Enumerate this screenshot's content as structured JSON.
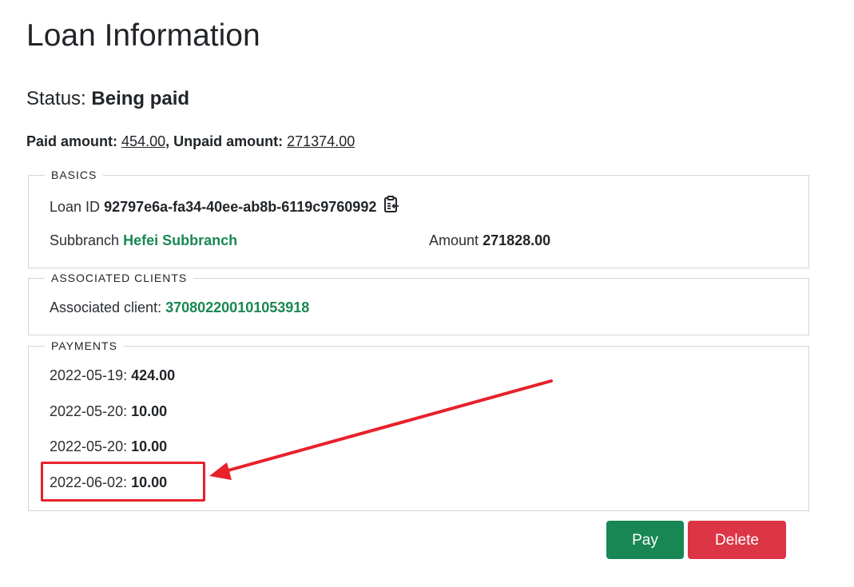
{
  "page": {
    "title": "Loan Information"
  },
  "status": {
    "label": "Status:",
    "value": "Being paid"
  },
  "amounts": {
    "paid_label": "Paid amount:",
    "paid_value": "454.00",
    "separator": ",",
    "unpaid_label": "Unpaid amount:",
    "unpaid_value": "271374.00"
  },
  "basics": {
    "legend": "BASICS",
    "loan_id_label": "Loan ID",
    "loan_id_value": "92797e6a-fa34-40ee-ab8b-6119c9760992",
    "copy_icon": "clipboard-copy-icon",
    "subbranch_label": "Subbranch",
    "subbranch_value": "Hefei Subbranch",
    "amount_label": "Amount",
    "amount_value": "271828.00"
  },
  "associated_clients": {
    "legend": "ASSOCIATED CLIENTS",
    "client_label": "Associated client:",
    "client_value": "370802200101053918"
  },
  "payments": {
    "legend": "PAYMENTS",
    "items": [
      {
        "date": "2022-05-19",
        "amount": "424.00"
      },
      {
        "date": "2022-05-20",
        "amount": "10.00"
      },
      {
        "date": "2022-05-20",
        "amount": "10.00"
      },
      {
        "date": "2022-06-02",
        "amount": "10.00"
      }
    ]
  },
  "actions": {
    "pay_label": "Pay",
    "delete_label": "Delete"
  },
  "colors": {
    "green": "#198754",
    "red": "#dc3545",
    "annotation": "#e8212b"
  }
}
